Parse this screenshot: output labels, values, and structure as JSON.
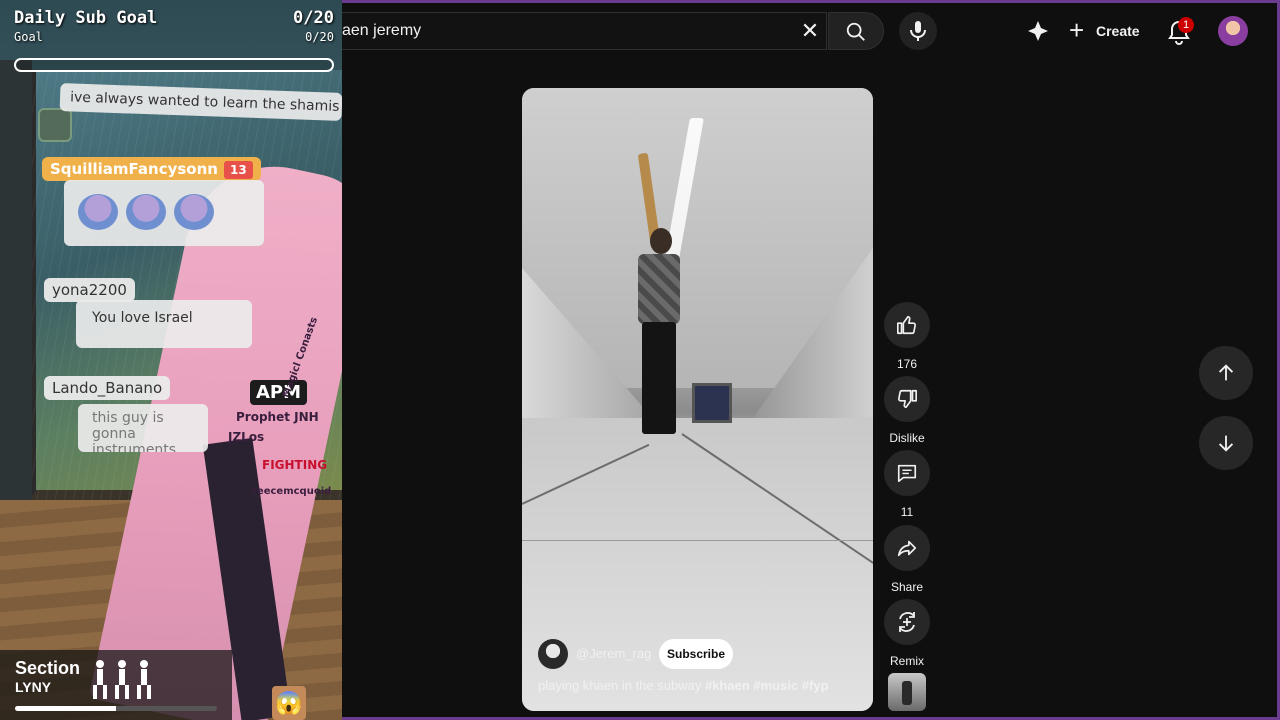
{
  "overlay": {
    "goal": {
      "title": "Daily Sub Goal",
      "subtitle": "Goal",
      "count": "0/20",
      "count_small": "0/20",
      "progress": 0
    },
    "chat": [
      {
        "user": "",
        "message": "ive always wanted to learn the shamis"
      },
      {
        "user": "SquilliamFancysonn",
        "badge": "13",
        "message": ""
      },
      {
        "user": "yona2200",
        "message": "You love Israel"
      },
      {
        "user": "Lando_Banano",
        "message": "this guy is gonna instruments ca"
      }
    ],
    "stickers": [
      "APM",
      "Prophet JNH",
      "JZLos",
      "FIGHTING",
      "reecemcquoid",
      "Magicl Conasts"
    ],
    "section_widget": {
      "title": "Section",
      "subtitle": "LYNY",
      "progress": 0.5
    }
  },
  "youtube": {
    "search": {
      "value": "aen jeremy",
      "clear_icon": "close-icon",
      "search_icon": "search-icon",
      "mic_icon": "mic-icon"
    },
    "header": {
      "create_label": "Create",
      "notification_count": "1"
    },
    "short": {
      "channel": "@Jerem_rag",
      "subscribe_label": "Subscribe",
      "title_plain": "playing khaen in the subway ",
      "title_tags": "#khaen #music #fyp"
    },
    "actions": {
      "like_count": "176",
      "dislike_label": "Dislike",
      "comment_count": "11",
      "share_label": "Share",
      "remix_label": "Remix"
    },
    "colors": {
      "background": "#0f0f0f",
      "button": "#272727",
      "badge": "#cc0000",
      "frame": "#6a3b8f"
    }
  }
}
